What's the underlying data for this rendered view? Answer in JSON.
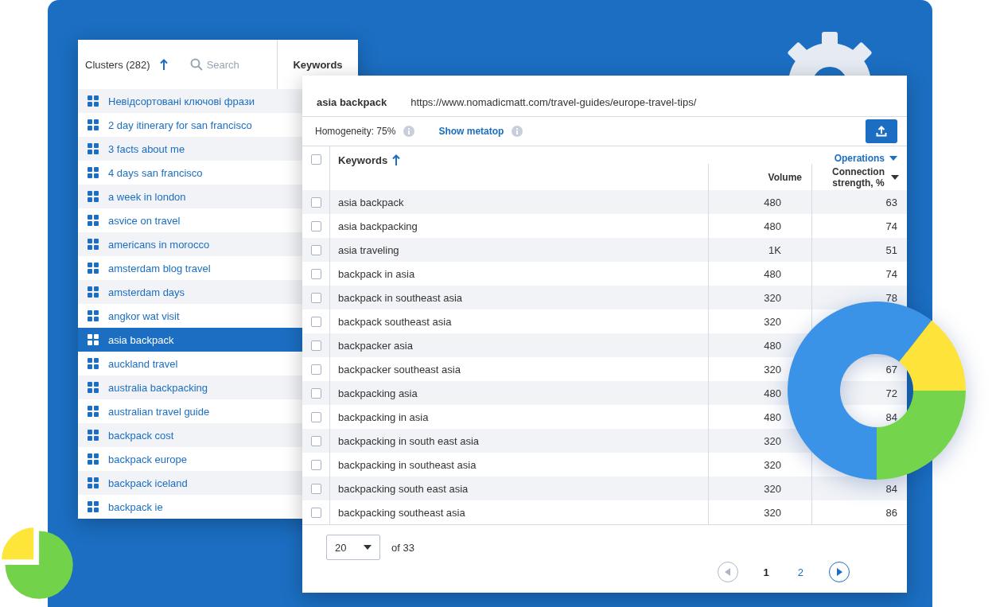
{
  "clusters_panel": {
    "title": "Clusters (282)",
    "search": {
      "placeholder": "Search"
    },
    "column_header": "Keywords",
    "items": [
      {
        "label": "Невідсортовані ключові фрази",
        "selected": false
      },
      {
        "label": "2 day itinerary for san francisco",
        "selected": false
      },
      {
        "label": "3 facts about me",
        "selected": false
      },
      {
        "label": "4 days san francisco",
        "selected": false
      },
      {
        "label": "a week in london",
        "selected": false
      },
      {
        "label": "asvice on travel",
        "selected": false
      },
      {
        "label": "americans in morocco",
        "selected": false
      },
      {
        "label": "amsterdam blog travel",
        "selected": false
      },
      {
        "label": "amsterdam days",
        "selected": false
      },
      {
        "label": "angkor wat visit",
        "selected": false
      },
      {
        "label": "asia backpack",
        "selected": true
      },
      {
        "label": "auckland travel",
        "selected": false
      },
      {
        "label": "australia backpacking",
        "selected": false
      },
      {
        "label": "australian travel guide",
        "selected": false
      },
      {
        "label": "backpack cost",
        "selected": false
      },
      {
        "label": "backpack europe",
        "selected": false
      },
      {
        "label": "backpack iceland",
        "selected": false
      },
      {
        "label": "backpack ie",
        "selected": false
      }
    ]
  },
  "keyword_panel": {
    "title": "asia backpack",
    "url": "https://www.nomadicmatt.com/travel-guides/europe-travel-tips/",
    "homogeneity": "Homogeneity: 75%",
    "metatop_link": "Show metatop",
    "operations": "Operations",
    "select_all": {
      "checked": false
    },
    "columns": [
      "Keywords",
      "Volume",
      "Connection strength, %"
    ],
    "rows": [
      {
        "keyword": "asia backpack",
        "volume": "480",
        "strength": "63",
        "checked": false
      },
      {
        "keyword": "asia backpacking",
        "volume": "480",
        "strength": "74",
        "checked": false
      },
      {
        "keyword": "asia traveling",
        "volume": "1K",
        "strength": "51",
        "checked": false
      },
      {
        "keyword": "backpack in asia",
        "volume": "480",
        "strength": "74",
        "checked": false
      },
      {
        "keyword": "backpack in southeast asia",
        "volume": "320",
        "strength": "78",
        "checked": false
      },
      {
        "keyword": "backpack southeast asia",
        "volume": "320",
        "checked": false
      },
      {
        "keyword": "backpacker asia",
        "volume": "480",
        "checked": false
      },
      {
        "keyword": "backpacker southeast asia",
        "volume": "320",
        "strength": "67",
        "checked": false
      },
      {
        "keyword": "backpacking asia",
        "volume": "480",
        "strength": "72",
        "checked": false
      },
      {
        "keyword": "backpacking in asia",
        "volume": "480",
        "strength": "84",
        "checked": false
      },
      {
        "keyword": "backpacking in south east asia",
        "volume": "320",
        "checked": false
      },
      {
        "keyword": "backpacking in southeast asia",
        "volume": "320",
        "checked": false
      },
      {
        "keyword": "backpacking south east asia",
        "volume": "320",
        "strength": "84",
        "checked": false
      },
      {
        "keyword": "backpacking southeast asia",
        "volume": "320",
        "strength": "86",
        "checked": false
      }
    ],
    "page_size": "20",
    "page_count": "of 33",
    "pages": [
      {
        "label": "1",
        "selected": true
      },
      {
        "label": "2",
        "selected": false
      }
    ],
    "prev": {
      "disabled": true
    },
    "next": {
      "disabled": false
    }
  }
}
